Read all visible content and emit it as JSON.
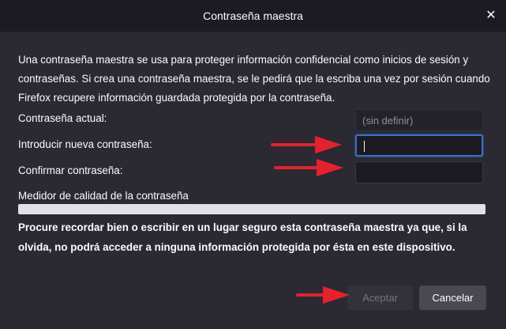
{
  "dialog": {
    "title": "Contraseña maestra",
    "close_glyph": "✕",
    "description": "Una contraseña maestra se usa para proteger información confidencial como inicios de sesión y contraseñas. Si crea una contraseña maestra, se le pedirá que la escriba una vez por sesión cuando Firefox recupere información guardada protegida por la contraseña."
  },
  "form": {
    "current_label": "Contraseña actual:",
    "current_placeholder": "(sin definir)",
    "new_label": "Introducir nueva contraseña:",
    "new_value": "",
    "confirm_label": "Confirmar contraseña:",
    "confirm_value": "",
    "meter_label": "Medidor de calidad de la contraseña",
    "meter_level": 0
  },
  "warning": "Procure recordar bien o escribir en un lugar seguro esta contraseña maestra ya que, si la olvida, no podrá acceder a ninguna información protegida por ésta en este dispositivo.",
  "buttons": {
    "accept_label": "Aceptar",
    "cancel_label": "Cancelar",
    "accept_enabled": false
  },
  "annotations": {
    "arrow_color": "#e8202e",
    "arrow_count": 3
  },
  "colors": {
    "dialog_bg": "#2b2a33",
    "titlebar_bg": "#1c1b22",
    "focus_border": "#3b6fc3",
    "meter_bg": "#e2e2e6"
  }
}
